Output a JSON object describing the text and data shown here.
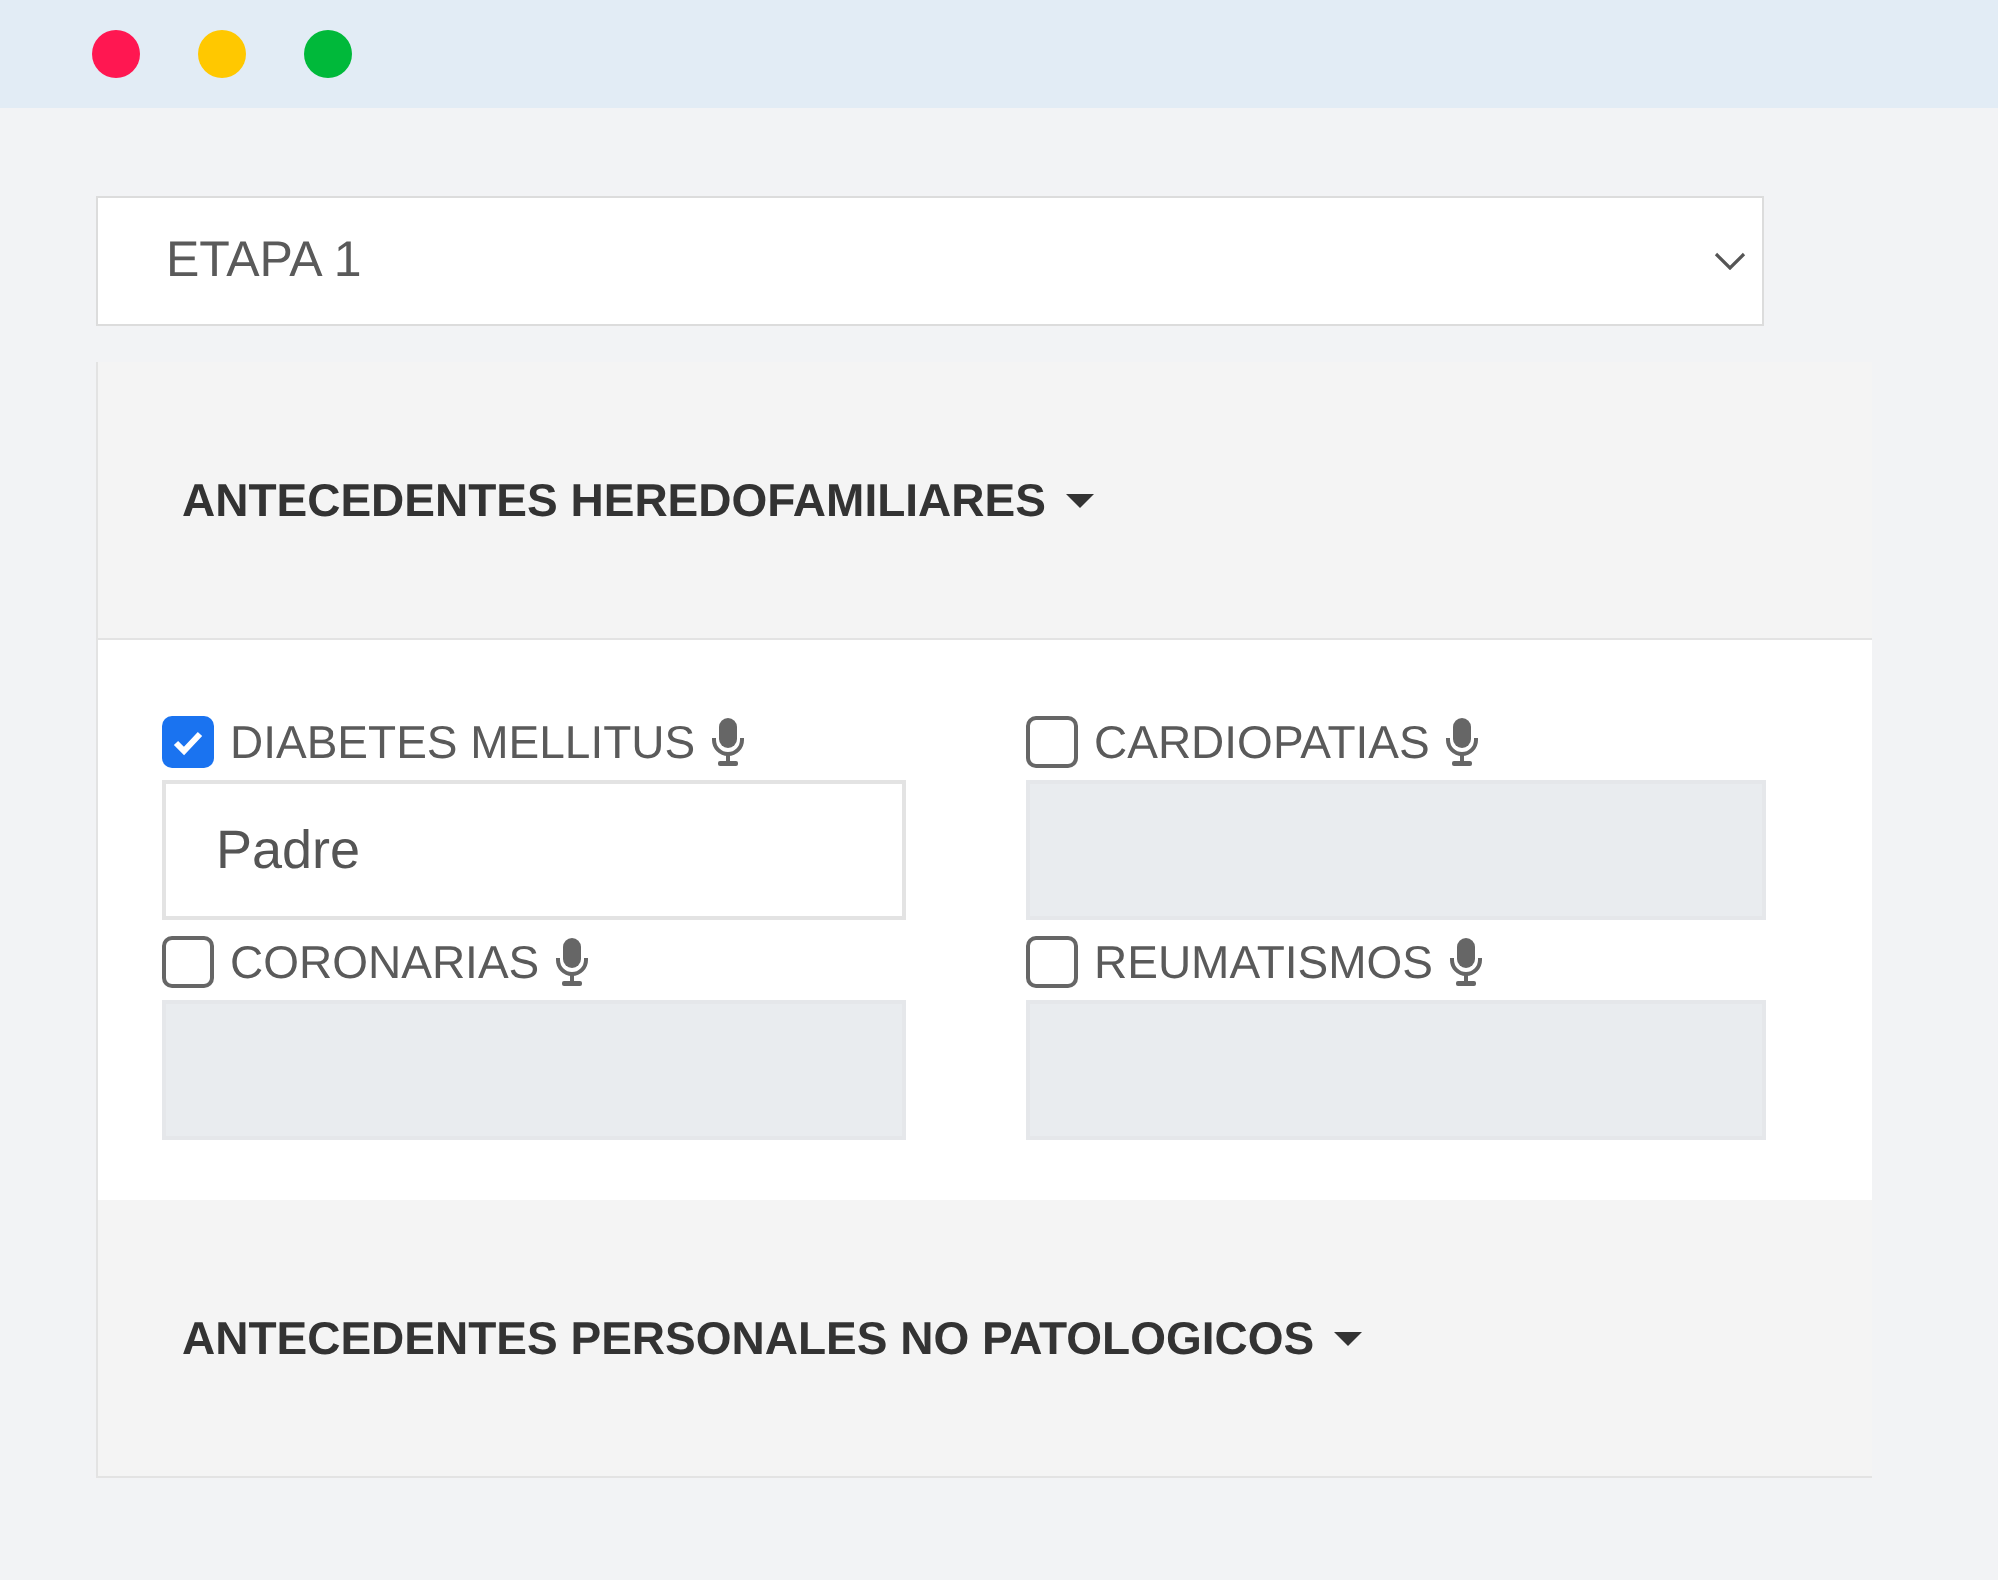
{
  "window": {
    "controls": [
      {
        "color": "#ff1751"
      },
      {
        "color": "#ffc800"
      },
      {
        "color": "#00b93a"
      }
    ]
  },
  "stage_select": {
    "value": "ETAPA 1"
  },
  "sections": [
    {
      "title": "ANTECEDENTES HEREDOFAMILIARES",
      "fields": [
        {
          "label": "DIABETES MELLITUS",
          "checked": true,
          "disabled": false,
          "value": "Padre"
        },
        {
          "label": "CARDIOPATIAS",
          "checked": false,
          "disabled": true
        },
        {
          "label": "CORONARIAS",
          "checked": false,
          "disabled": true
        },
        {
          "label": "REUMATISMOS",
          "checked": false,
          "disabled": true
        }
      ]
    },
    {
      "title": "ANTECEDENTES PERSONALES NO PATOLOGICOS"
    }
  ]
}
